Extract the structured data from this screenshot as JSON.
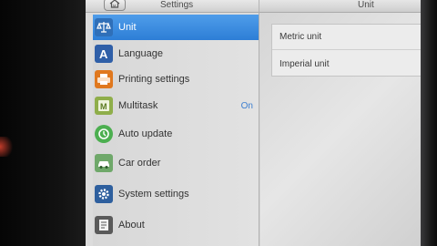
{
  "header": {
    "left_title": "Settings",
    "right_title": "Unit",
    "home_icon": "home-icon"
  },
  "sidebar": {
    "items": [
      {
        "label": "Unit",
        "icon": "scale-icon",
        "active": true,
        "value": ""
      },
      {
        "label": "Language",
        "icon": "language-icon",
        "active": false,
        "value": ""
      },
      {
        "label": "Printing settings",
        "icon": "printer-icon",
        "active": false,
        "value": ""
      },
      {
        "label": "Multitask",
        "icon": "multitask-icon",
        "active": false,
        "value": "On"
      },
      {
        "label": "Auto update",
        "icon": "update-icon",
        "active": false,
        "value": ""
      },
      {
        "label": "Car order",
        "icon": "car-icon",
        "active": false,
        "value": ""
      },
      {
        "label": "System settings",
        "icon": "gear-icon",
        "active": false,
        "value": ""
      },
      {
        "label": "About",
        "icon": "document-icon",
        "active": false,
        "value": ""
      }
    ]
  },
  "content": {
    "options": [
      {
        "label": "Metric unit"
      },
      {
        "label": "Imperial unit"
      }
    ]
  },
  "colors": {
    "accent": "#2d7ed6",
    "value_text": "#3d7fd0"
  }
}
